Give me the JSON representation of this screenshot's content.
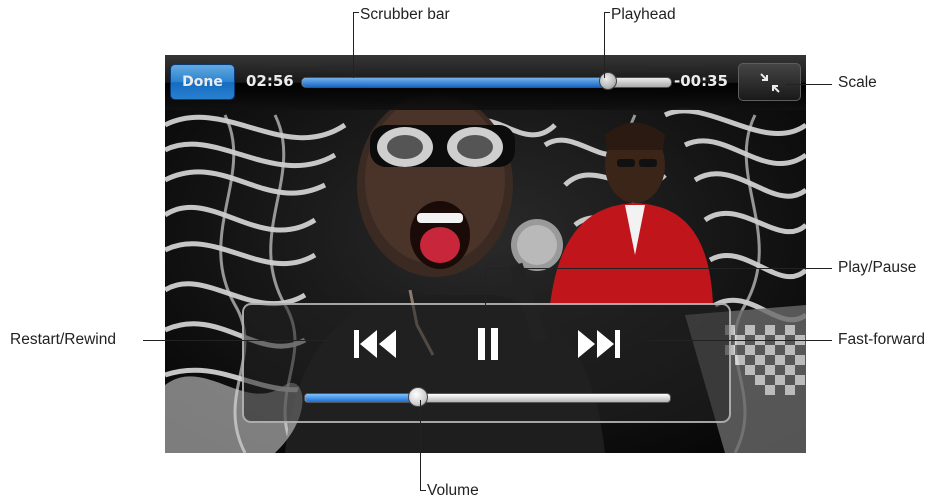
{
  "player": {
    "done_label": "Done",
    "elapsed": "02:56",
    "remaining": "-00:35",
    "scrubber_progress": 0.83,
    "volume_level": 0.31,
    "accent_color": "#1b6fd3"
  },
  "icons": {
    "scale": "scale-collapse-icon",
    "rewind": "restart-rewind-icon",
    "play_pause": "pause-icon",
    "fast_forward": "fast-forward-icon"
  },
  "callouts": {
    "scrubber": "Scrubber bar",
    "playhead": "Playhead",
    "scale": "Scale",
    "play_pause": "Play/Pause",
    "restart_rewind": "Restart/Rewind",
    "fast_forward": "Fast-forward",
    "volume": "Volume"
  }
}
